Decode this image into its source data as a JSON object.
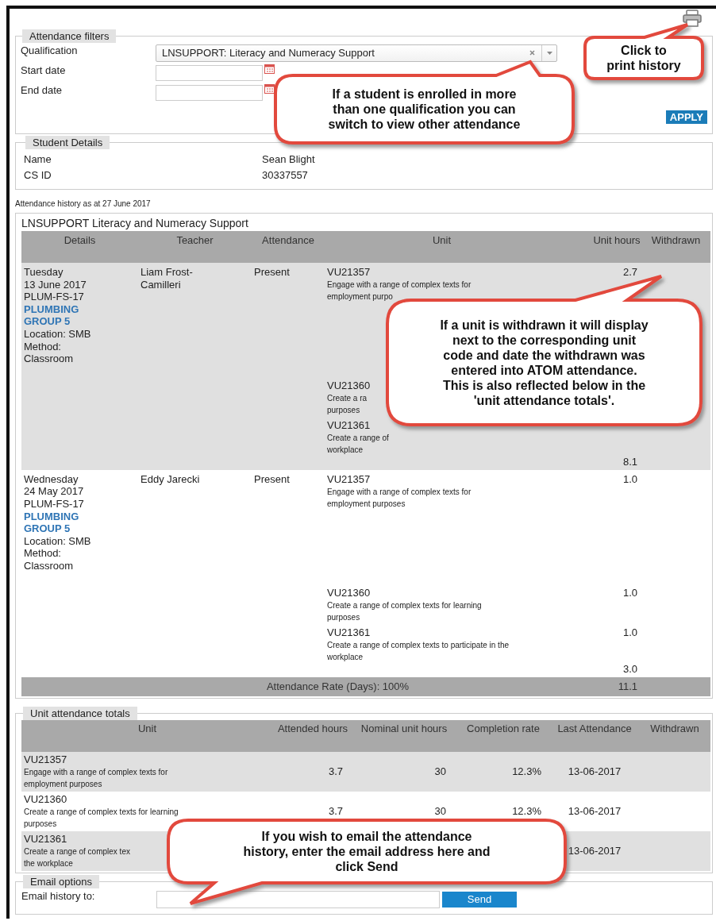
{
  "filters": {
    "legend": "Attendance filters",
    "qualification": {
      "label": "Qualification",
      "value": "LNSUPPORT: Literacy and Numeracy Support"
    },
    "start_date": {
      "label": "Start date"
    },
    "end_date": {
      "label": "End date"
    },
    "apply_button": "APPLY"
  },
  "student_details": {
    "legend": "Student Details",
    "fields": [
      {
        "label": "Name",
        "value": "Sean Blight"
      },
      {
        "label": "CS ID",
        "value": "30337557"
      }
    ]
  },
  "history_caption": "Attendance history as at 27 June 2017",
  "attendance": {
    "title": "LNSUPPORT Literacy and Numeracy Support",
    "columns": [
      "Details",
      "Teacher",
      "Attendance",
      "Unit",
      "Unit hours",
      "Withdrawn"
    ],
    "rows": [
      {
        "day": "Tuesday",
        "date": "13 June 2017",
        "class_code": "PLUM-FS-17",
        "group": "PLUMBING GROUP 5",
        "location": "Location: SMB",
        "method": "Method: Classroom",
        "teacher": "Liam Frost-Camilleri",
        "attendance": "Present",
        "units": [
          {
            "code": "VU21357",
            "description": [
              "Engage with a range of complex texts for",
              "employment purpo"
            ],
            "hours": "2.7"
          },
          {
            "code": "VU21360",
            "description": [
              "Create a ra",
              "purposes"
            ]
          },
          {
            "code": "VU21361",
            "description": [
              "Create a range of",
              "workplace"
            ]
          }
        ],
        "total": "8.1"
      },
      {
        "day": "Wednesday",
        "date": "24 May 2017",
        "class_code": "PLUM-FS-17",
        "group": "PLUMBING GROUP 5",
        "location": "Location: SMB",
        "method": "Method: Classroom",
        "teacher": "Eddy Jarecki",
        "attendance": "Present",
        "units": [
          {
            "code": "VU21357",
            "description": [
              "Engage with a range of complex texts for",
              "employment purposes"
            ],
            "hours": "1.0"
          },
          {
            "code": "VU21360",
            "description": [
              "Create a range of complex texts for learning",
              "purposes"
            ],
            "hours": "1.0"
          },
          {
            "code": "VU21361",
            "description": [
              "Create a range of complex texts to participate in the",
              "workplace"
            ],
            "hours": "1.0"
          }
        ],
        "total": "3.0"
      }
    ],
    "footer": {
      "rate": "Attendance Rate (Days): 100%",
      "total_hours": "11.1"
    }
  },
  "unit_totals": {
    "legend": "Unit attendance totals",
    "columns": [
      "Unit",
      "Attended hours",
      "Nominal unit hours",
      "Completion rate",
      "Last Attendance",
      "Withdrawn"
    ],
    "rows": [
      {
        "code": "VU21357",
        "description": [
          "Engage with a range of complex texts for",
          "employment purposes"
        ],
        "attended": "3.7",
        "nominal": "30",
        "completion": "12.3%",
        "last": "13-06-2017"
      },
      {
        "code": "VU21360",
        "description": [
          "Create a range of complex texts for learning",
          "purposes"
        ],
        "attended": "3.7",
        "nominal": "30",
        "completion": "12.3%",
        "last": "13-06-2017"
      },
      {
        "code": "VU21361",
        "description": [
          "Create a range of complex tex",
          "the workplace"
        ],
        "last": "13-06-2017"
      }
    ]
  },
  "email": {
    "legend": "Email options",
    "label": "Email history to:",
    "send_button": "Send"
  },
  "callouts": [
    {
      "lines": [
        "Click to",
        "print history"
      ]
    },
    {
      "lines": [
        "If a student is enrolled in more",
        "than one qualification you can",
        "switch to view other attendance"
      ]
    },
    {
      "lines": [
        "If a unit is withdrawn it will display",
        "next to the corresponding unit",
        "code and date the withdrawn was",
        "entered into ATOM attendance.",
        "This is also reflected below in the",
        "'unit attendance totals'."
      ]
    },
    {
      "lines": [
        "If you wish to email the attendance",
        "history, enter the email address here and",
        "click Send"
      ]
    }
  ]
}
